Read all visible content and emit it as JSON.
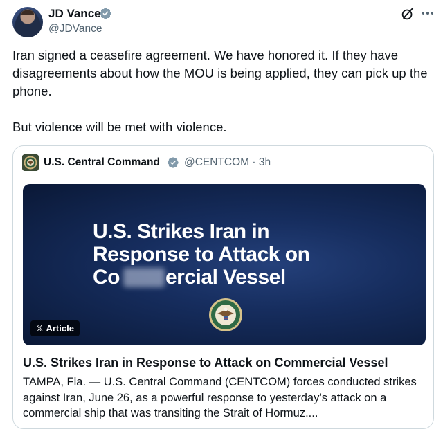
{
  "author": {
    "name": "JD Vance",
    "handle": "@JDVance",
    "verified_color": "#829aab"
  },
  "tweet": {
    "paragraphs": [
      "Iran signed a ceasefire agreement. We have honored it. If they have disagreements about how the MOU is being applied, they can pick up the phone.",
      "But violence will be met with violence."
    ]
  },
  "icons": {
    "grok": "grok-icon",
    "more": "more-options-icon",
    "verified": "verified-badge-icon",
    "seal": "centcom-seal-icon"
  },
  "quote": {
    "name": "U.S. Central Command",
    "handle": "@CENTCOM",
    "separator": "·",
    "time": "3h",
    "image": {
      "headline_line1": "U.S. Strikes Iran in",
      "headline_line2": "Response to Attack on",
      "headline_line3_start": "Co",
      "headline_line3_end": "ercial Vessel",
      "badge_label": "Article",
      "badge_x": "𝕏"
    },
    "article_title": "U.S. Strikes Iran in Response to Attack on Commercial Vessel",
    "article_summary": "TAMPA, Fla. — U.S. Central Command (CENTCOM) forces conducted strikes against Iran, June 26, as a powerful response to yesterday’s attack on a commercial ship that was transiting the Strait of Hormuz...."
  },
  "colors": {
    "text_primary": "#0f1419",
    "text_secondary": "#536471",
    "border": "#cfd9de",
    "image_bg": "#162d5e"
  }
}
